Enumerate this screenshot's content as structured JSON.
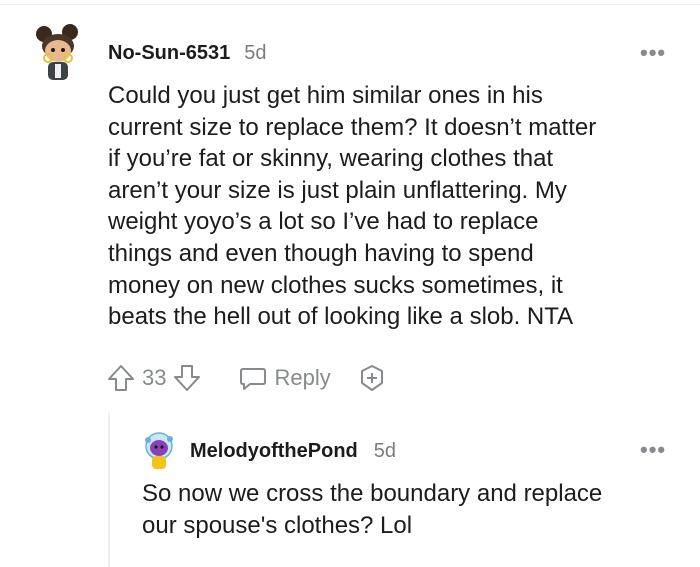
{
  "comment": {
    "username": "No-Sun-6531",
    "time": "5d",
    "more": "•••",
    "lines": [
      "Could you just get him similar ones in his",
      "current size to replace them? It doesn’t matter",
      "if you’re fat or skinny, wearing clothes that",
      "aren’t your size is just plain unflattering. My",
      "weight yoyo’s a lot so I’ve had to replace",
      "things and even though having to spend",
      "money on new clothes sucks sometimes, it",
      "beats the hell out of looking like a slob. NTA"
    ],
    "votes": "33",
    "reply_label": "Reply"
  },
  "reply": {
    "username": "MelodyofthePond",
    "time": "5d",
    "more": "•••",
    "lines": [
      "So now we cross the boundary and replace",
      "our spouse's clothes? Lol"
    ]
  },
  "icons": {
    "upvote": "upvote-arrow-icon",
    "downvote": "downvote-arrow-icon",
    "reply": "speech-bubble-icon",
    "award": "award-plus-icon",
    "more": "more-horizontal-icon"
  }
}
